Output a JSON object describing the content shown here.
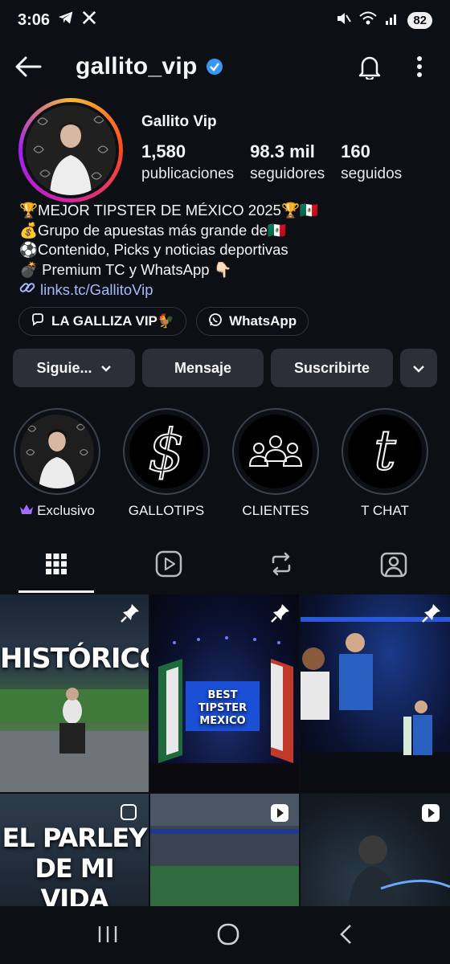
{
  "status": {
    "time": "3:06",
    "battery": "82"
  },
  "header": {
    "username": "gallito_vip"
  },
  "profile": {
    "display_name": "Gallito Vip",
    "stats": [
      {
        "value": "1,580",
        "label": "publicaciones"
      },
      {
        "value": "98.3 mil",
        "label": "seguidores"
      },
      {
        "value": "160",
        "label": "seguidos"
      }
    ]
  },
  "bio": {
    "lines": [
      "🏆MEJOR TIPSTER DE MÉXICO 2025🏆🇲🇽",
      "💰Grupo de apuestas más grande de🇲🇽",
      "⚽Contenido, Picks y noticias deportivas",
      "💣 Premium TC y WhatsApp 👇🏻"
    ],
    "link": "links.tc/GallitoVip"
  },
  "chips": [
    {
      "label": "LA GALLIZA VIP🐓",
      "icon": "threads-icon"
    },
    {
      "label": "WhatsApp",
      "icon": "whatsapp-icon"
    }
  ],
  "actions": {
    "following": "Siguie...",
    "message": "Mensaje",
    "subscribe": "Suscribirte"
  },
  "highlights": [
    {
      "label": "Exclusivo",
      "icon": "crown-icon"
    },
    {
      "label": "GALLOTIPS"
    },
    {
      "label": "CLIENTES"
    },
    {
      "label": "T CHAT"
    }
  ],
  "posts": {
    "p1_text": "HISTÓRICO",
    "p2_text_line1": "BEST TIPSTER",
    "p2_text_line2": "MEXICO",
    "p4_text_line1": "EL PARLEY",
    "p4_text_line2": "DE MI VIDA"
  },
  "colors": {
    "verified": "#3897f0",
    "link": "#a8b8ff",
    "highlight_crown": "#a46bff"
  }
}
